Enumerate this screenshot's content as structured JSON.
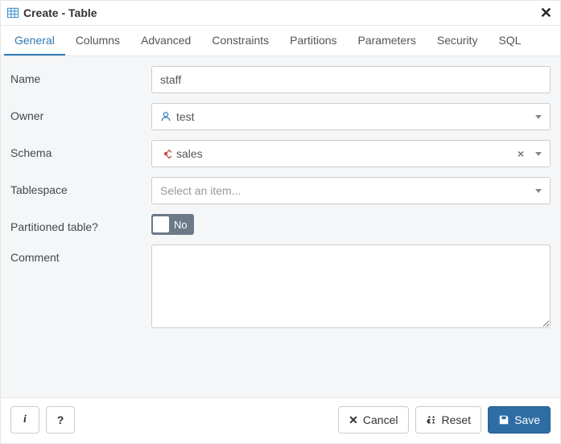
{
  "window": {
    "title": "Create - Table"
  },
  "tabs": {
    "general": "General",
    "columns": "Columns",
    "advanced": "Advanced",
    "constraints": "Constraints",
    "partitions": "Partitions",
    "parameters": "Parameters",
    "security": "Security",
    "sql": "SQL"
  },
  "labels": {
    "name": "Name",
    "owner": "Owner",
    "schema": "Schema",
    "tablespace": "Tablespace",
    "partitioned": "Partitioned table?",
    "comment": "Comment"
  },
  "fields": {
    "name_value": "staff",
    "owner_value": "test",
    "schema_value": "sales",
    "tablespace_placeholder": "Select an item...",
    "partitioned_toggle": "No",
    "comment_value": ""
  },
  "buttons": {
    "info": "i",
    "help": "?",
    "cancel": "Cancel",
    "reset": "Reset",
    "save": "Save"
  }
}
